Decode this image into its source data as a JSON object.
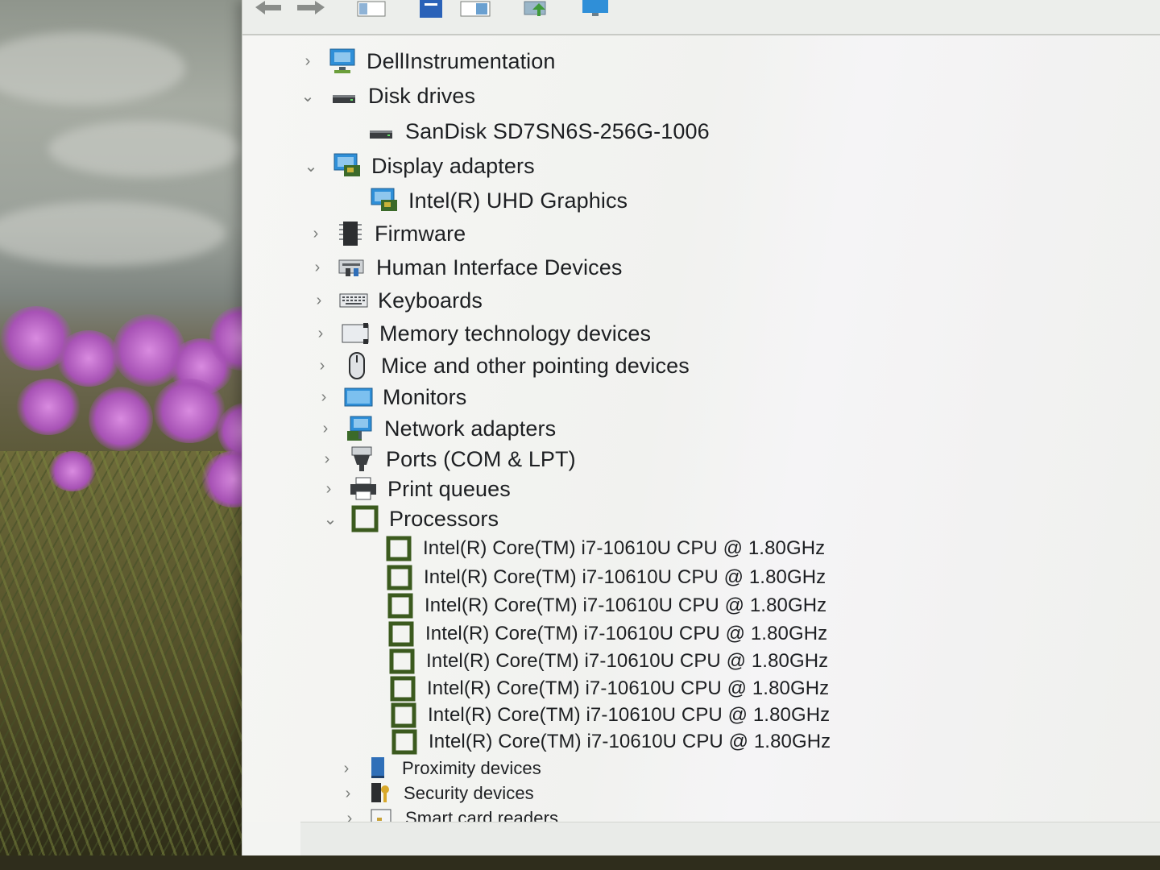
{
  "tree": [
    {
      "label": "DellInstrumentation",
      "state": "collapsed",
      "icon": "monitor-network-icon"
    },
    {
      "label": "Disk drives",
      "state": "expanded",
      "icon": "disk-drive-icon"
    },
    {
      "label": "SanDisk SD7SN6S-256G-1006",
      "state": "leaf",
      "icon": "disk-drive-icon"
    },
    {
      "label": "Display adapters",
      "state": "expanded",
      "icon": "display-adapter-icon"
    },
    {
      "label": "Intel(R) UHD Graphics",
      "state": "leaf",
      "icon": "display-adapter-icon"
    },
    {
      "label": "Firmware",
      "state": "collapsed",
      "icon": "firmware-chip-icon"
    },
    {
      "label": "Human Interface Devices",
      "state": "collapsed",
      "icon": "hid-icon"
    },
    {
      "label": "Keyboards",
      "state": "collapsed",
      "icon": "keyboard-icon"
    },
    {
      "label": "Memory technology devices",
      "state": "collapsed",
      "icon": "memory-card-icon"
    },
    {
      "label": "Mice and other pointing devices",
      "state": "collapsed",
      "icon": "mouse-icon"
    },
    {
      "label": "Monitors",
      "state": "collapsed",
      "icon": "monitor-icon"
    },
    {
      "label": "Network adapters",
      "state": "collapsed",
      "icon": "network-adapter-icon"
    },
    {
      "label": "Ports (COM & LPT)",
      "state": "collapsed",
      "icon": "port-icon"
    },
    {
      "label": "Print queues",
      "state": "collapsed",
      "icon": "printer-icon"
    },
    {
      "label": "Processors",
      "state": "expanded",
      "icon": "processor-icon"
    },
    {
      "label": "Intel(R) Core(TM) i7-10610U CPU @ 1.80GHz",
      "state": "leaf",
      "icon": "processor-icon"
    },
    {
      "label": "Intel(R) Core(TM) i7-10610U CPU @ 1.80GHz",
      "state": "leaf",
      "icon": "processor-icon"
    },
    {
      "label": "Intel(R) Core(TM) i7-10610U CPU @ 1.80GHz",
      "state": "leaf",
      "icon": "processor-icon"
    },
    {
      "label": "Intel(R) Core(TM) i7-10610U CPU @ 1.80GHz",
      "state": "leaf",
      "icon": "processor-icon"
    },
    {
      "label": "Intel(R) Core(TM) i7-10610U CPU @ 1.80GHz",
      "state": "leaf",
      "icon": "processor-icon"
    },
    {
      "label": "Intel(R) Core(TM) i7-10610U CPU @ 1.80GHz",
      "state": "leaf",
      "icon": "processor-icon"
    },
    {
      "label": "Intel(R) Core(TM) i7-10610U CPU @ 1.80GHz",
      "state": "leaf",
      "icon": "processor-icon"
    },
    {
      "label": "Intel(R) Core(TM) i7-10610U CPU @ 1.80GHz",
      "state": "leaf",
      "icon": "processor-icon"
    },
    {
      "label": "Proximity devices",
      "state": "collapsed",
      "icon": "proximity-icon"
    },
    {
      "label": "Security devices",
      "state": "collapsed",
      "icon": "security-icon"
    },
    {
      "label": "Smart card readers",
      "state": "collapsed",
      "icon": "smart-card-reader-icon"
    }
  ],
  "toolbar": {
    "buttons": [
      {
        "name": "back-button",
        "icon": "back-arrow-icon"
      },
      {
        "name": "forward-button",
        "icon": "forward-arrow-icon"
      },
      {
        "name": "show-hide-console-tree-button",
        "icon": "console-tree-icon"
      },
      {
        "name": "properties-button",
        "icon": "properties-icon"
      },
      {
        "name": "help-button",
        "icon": "help-icon"
      },
      {
        "name": "scan-hardware-changes-button",
        "icon": "scan-hardware-icon"
      },
      {
        "name": "monitor-button",
        "icon": "monitor-icon"
      }
    ]
  },
  "colors": {
    "window_bg": "#f3f4f2",
    "text": "#1d1f22",
    "processor_green": "#3b5a1e",
    "monitor_blue": "#2f8fd8"
  }
}
